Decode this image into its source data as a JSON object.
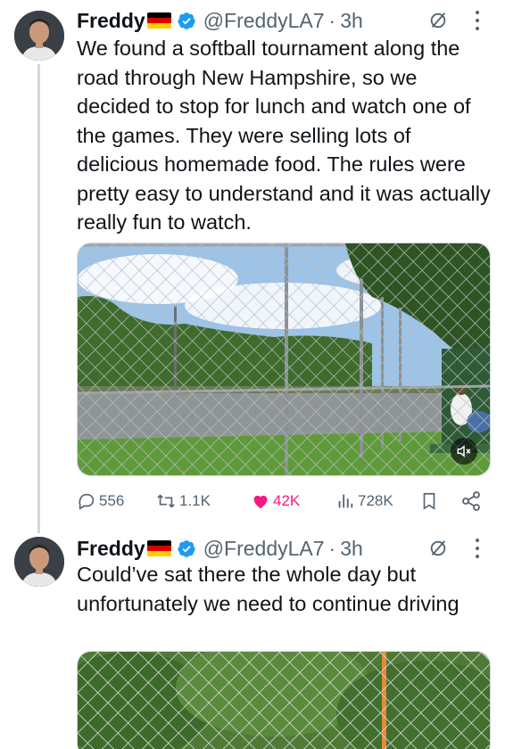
{
  "author": {
    "display_name": "Freddy",
    "handle": "@FreddyLA7",
    "flag": "german-flag",
    "verified": true
  },
  "tweets": [
    {
      "time": "3h",
      "separator": "·",
      "text": "We found a softball tournament along the road through New Hampshire, so we decided to stop for lunch and watch one of the games. They were selling lots of delicious homemade food. The rules were pretty easy to understand and it was actually really fun to watch.",
      "media": "video",
      "actions": {
        "replies": "556",
        "retweets": "1.1K",
        "likes": "42K",
        "views": "728K"
      }
    },
    {
      "time": "3h",
      "separator": "·",
      "text": "Could’ve sat there the whole day but unfortunately we need to continue driving",
      "media": "image"
    }
  ],
  "colors": {
    "text": "#0f1419",
    "secondary": "#536471",
    "verified": "#1d9bf0",
    "like": "#f91880",
    "thread_line": "#cfd9de"
  },
  "icons": {
    "reply": "reply-icon",
    "retweet": "retweet-icon",
    "like": "heart-icon",
    "views": "views-icon",
    "bookmark": "bookmark-icon",
    "share": "share-icon",
    "mute": "muted-speaker-icon",
    "grok": "grok-icon",
    "more": "more-icon"
  }
}
